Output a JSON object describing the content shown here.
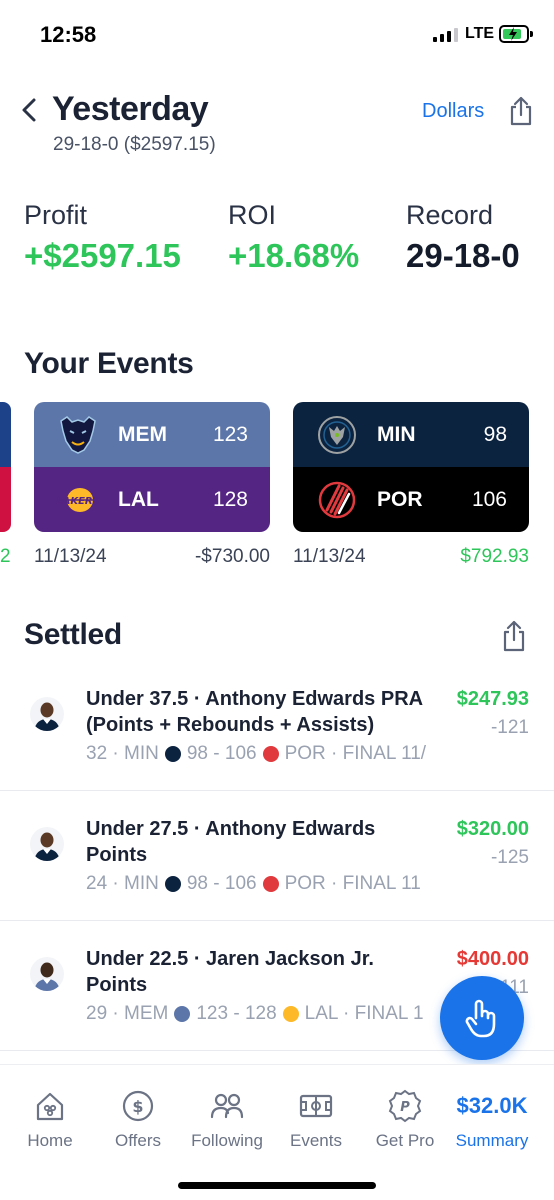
{
  "status_bar": {
    "time": "12:58",
    "network": "LTE"
  },
  "header": {
    "title": "Yesterday",
    "subtitle": "29-18-0 ($2597.15)",
    "currency_toggle": "Dollars"
  },
  "stats": [
    {
      "label": "Profit",
      "value": "+$2597.15",
      "color": "#2ec55a"
    },
    {
      "label": "ROI",
      "value": "+18.68%",
      "color": "#2ec55a"
    },
    {
      "label": "Record",
      "value": "29-18-0",
      "color": "#141b2a"
    }
  ],
  "events_section": {
    "title": "Your Events",
    "partial_amount": "2",
    "events": [
      {
        "home": {
          "abbr": "MEM",
          "score": "123",
          "color": "#5d76a9",
          "logo": "grizzlies-logo"
        },
        "away": {
          "abbr": "LAL",
          "score": "128",
          "color": "#552583",
          "logo": "lakers-logo"
        },
        "date": "11/13/24",
        "amount": "-$730.00",
        "amount_color": "#3b4356"
      },
      {
        "home": {
          "abbr": "MIN",
          "score": "98",
          "color": "#0c2340",
          "logo": "timberwolves-logo"
        },
        "away": {
          "abbr": "POR",
          "score": "106",
          "color": "#000000",
          "logo": "trail-blazers-logo"
        },
        "date": "11/13/24",
        "amount": "$792.93",
        "amount_color": "#2ec55a"
      }
    ]
  },
  "settled_section": {
    "title": "Settled",
    "bets": [
      {
        "title": "Under 37.5 · Anthony Edwards PRA (Points + Rebounds + Assists)",
        "amount": "$247.93",
        "amount_color": "#2ec55a",
        "odds": "-121",
        "meta_pre": "32 · MIN",
        "meta_score": "98 - 106",
        "meta_post": "POR · FINAL 11/"
      },
      {
        "title": "Under 27.5 · Anthony Edwards Points",
        "amount": "$320.00",
        "amount_color": "#2ec55a",
        "odds": "-125",
        "meta_pre": "24 · MIN",
        "meta_score": "98 - 106",
        "meta_post": "POR · FINAL 11"
      },
      {
        "title": "Under 22.5 · Jaren Jackson Jr. Points",
        "amount": "$400.00",
        "amount_color": "#e53935",
        "odds": "-111",
        "meta_pre": "29 · MEM",
        "meta_score": "123 - 128",
        "meta_post": "LAL · FINAL 1"
      }
    ]
  },
  "tab_bar": {
    "tabs": [
      {
        "label": "Home",
        "icon": "home-icon"
      },
      {
        "label": "Offers",
        "icon": "dollar-circle-icon"
      },
      {
        "label": "Following",
        "icon": "people-icon"
      },
      {
        "label": "Events",
        "icon": "scoreboard-icon"
      },
      {
        "label": "Get Pro",
        "icon": "pro-badge-icon"
      },
      {
        "label": "Summary",
        "value": "$32.0K"
      }
    ]
  }
}
